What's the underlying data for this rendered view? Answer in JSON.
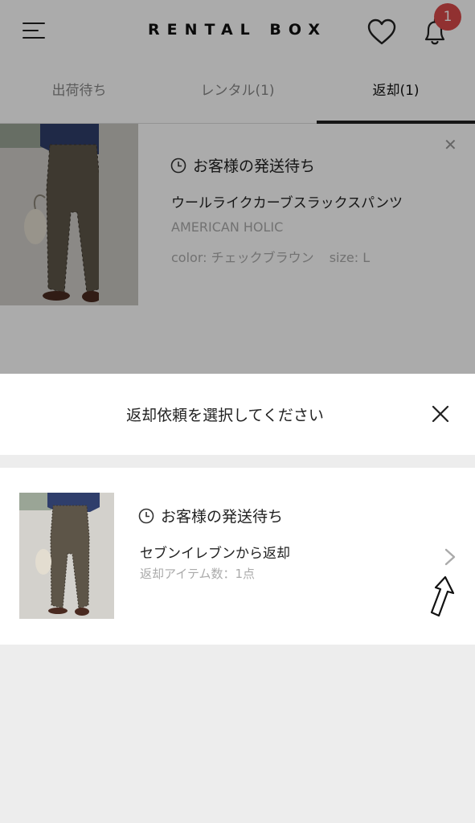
{
  "header": {
    "app_title": "RENTAL BOX",
    "notification_count": "1"
  },
  "tabs": [
    {
      "label": "出荷待ち"
    },
    {
      "label": "レンタル(1)"
    },
    {
      "label": "返却(1)"
    }
  ],
  "active_tab": 2,
  "item": {
    "status": "お客様の発送待ち",
    "name": "ウールライクカーブスラックスパンツ",
    "brand": "AMERICAN HOLIC",
    "color": "color: チェックブラウン",
    "size": "size: L"
  },
  "sheet": {
    "title": "返却依頼を選択してください",
    "option": {
      "status": "お客様の発送待ち",
      "method": "セブンイレブンから返却",
      "count": "返却アイテム数：1点"
    }
  },
  "colors": {
    "badge": "#d94a4a",
    "sheet_bg": "#ededed",
    "overlay": "rgba(0,0,0,0.33)"
  }
}
